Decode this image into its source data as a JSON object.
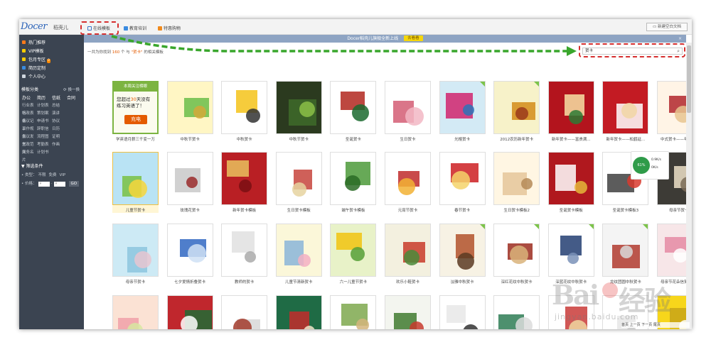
{
  "app": {
    "logo": "Docer",
    "logo_cn": "稻壳儿",
    "tabs": [
      {
        "label": "在线模板",
        "icon": "template-tab-icon"
      },
      {
        "label": "教育培训",
        "icon": "education-tab-icon"
      },
      {
        "label": "特惠购物",
        "icon": "shopping-tab-icon"
      }
    ],
    "new_doc_label": "新建空白文档"
  },
  "sidebar": {
    "nav": [
      {
        "label": "热门推荐",
        "color": "#ff7a1a"
      },
      {
        "label": "VIP模板",
        "color": "#ffcc00"
      },
      {
        "label": "包月专区",
        "color": "#ffcc00",
        "badge": "0"
      },
      {
        "label": "简历定制",
        "color": "#3a8be0"
      },
      {
        "label": "个人中心",
        "color": "#cfd6de"
      }
    ],
    "category_title": "模板分类",
    "swap_label": "换一换",
    "categories": [
      [
        "办公",
        "简历",
        "信纸",
        "合同"
      ],
      [
        "行业表格",
        "计划表",
        "总结"
      ],
      [
        "行政表格",
        "策划案",
        "演讲"
      ],
      [
        "会议记录",
        "申请书",
        "协议"
      ],
      [
        "工作规划",
        "辞职信",
        "日历"
      ],
      [
        "会议发言",
        "流程图",
        "证明"
      ],
      [
        "党政范文",
        "考勤表",
        "作画"
      ],
      [
        "商务名片",
        "计划书"
      ]
    ],
    "filter_title": "筛选条件",
    "filter_type_label": "• 类型：",
    "filter_type_options": [
      "不限",
      "免费",
      "VIP"
    ],
    "filter_price_label": "• 价格：",
    "filter_price_min": "¥",
    "filter_price_max": "¥",
    "go_label": "GO"
  },
  "banner": {
    "text": "Docer稻壳儿旗舰全新上线",
    "button": "去看看",
    "close": "×"
  },
  "results": {
    "prefix": "一共为你找到",
    "count": "160",
    "middle": "个 与",
    "keyword": "\"贺卡\"",
    "suffix": "的相关模板"
  },
  "search": {
    "value": "贺卡"
  },
  "ad_tile": {
    "header": "本周关注榜眼",
    "line1_a": "您超过",
    "line1_num": "30",
    "line1_b": "天没有",
    "line2": "练习英语了！",
    "button": "充电"
  },
  "templates": [
    {
      "caption": "学英语月薪三千变一万",
      "ad": true
    },
    {
      "caption": "中秋节贺卡",
      "palette": [
        "#fff6c4",
        "#6bbd4a",
        "#d4a838"
      ]
    },
    {
      "caption": "中秋贺卡",
      "palette": [
        "#ffffff",
        "#f4c31a",
        "#333333"
      ]
    },
    {
      "caption": "中秋节贺卡",
      "palette": [
        "#2b3a1f",
        "#3e6b2a",
        "#8cc047"
      ]
    },
    {
      "caption": "圣诞贺卡",
      "palette": [
        "#ffffff",
        "#b2271f",
        "#1b6a2f"
      ]
    },
    {
      "caption": "生日贺卡",
      "palette": [
        "#ffffff",
        "#d35d74",
        "#f2b7c4"
      ]
    },
    {
      "caption": "光棍贺卡",
      "palette": [
        "#d3eaf5",
        "#d0246d",
        "#2d73b9"
      ],
      "corner": true
    },
    {
      "caption": "2012农历新年贺卡",
      "palette": [
        "#f7f2c9",
        "#d38c19",
        "#9a3a1b"
      ],
      "corner": true
    },
    {
      "caption": "新年贺卡——富贵满...",
      "palette": [
        "#b3141d",
        "#f7e1a4",
        "#2c7a35"
      ]
    },
    {
      "caption": "新年贺卡——松鹤延...",
      "palette": [
        "#c31b23",
        "#ffffff",
        "#f1d6a4"
      ]
    },
    {
      "caption": "中式贺卡——年年有余",
      "palette": [
        "#fff4e6",
        "#b1262c",
        "#e8c48f"
      ]
    },
    {
      "caption": "儿童节贺卡",
      "palette": [
        "#b9e3f4",
        "#79c143",
        "#f7d63c"
      ],
      "selected": true
    },
    {
      "caption": "玫瑰花贺卡",
      "palette": [
        "#ffffff",
        "#c9c9c9",
        "#9a2b2b"
      ]
    },
    {
      "caption": "新年贺卡模板",
      "palette": [
        "#b91f24",
        "#e9c25e",
        "#7a0f13"
      ]
    },
    {
      "caption": "生日贺卡模板",
      "palette": [
        "#ffffff",
        "#c7443c",
        "#e6d4a0"
      ]
    },
    {
      "caption": "端午贺卡模板",
      "palette": [
        "#ffffff",
        "#4c9a3a",
        "#2a6b25"
      ]
    },
    {
      "caption": "元宵节贺卡",
      "palette": [
        "#ffffff",
        "#c02a2a",
        "#f2b134"
      ]
    },
    {
      "caption": "春节贺卡",
      "palette": [
        "#ffffff",
        "#cd1f22",
        "#f4d36a"
      ]
    },
    {
      "caption": "生日贺卡模板2",
      "palette": [
        "#fff6e3",
        "#e5c69a",
        "#b58a57"
      ]
    },
    {
      "caption": "圣诞贺卡模板",
      "palette": [
        "#b0181e",
        "#ffffff",
        "#e5b73a"
      ]
    },
    {
      "caption": "圣诞贺卡模板3",
      "palette": [
        "#ffffff",
        "#3f3f3f",
        "#d83a2e"
      ]
    },
    {
      "caption": "母亲节贺卡2",
      "palette": [
        "#3d3b36",
        "#ece0c7",
        "#7a6b58"
      ]
    },
    {
      "caption": "母亲节贺卡",
      "palette": [
        "#cdeaf5",
        "#8cc6de",
        "#e7c6d0"
      ]
    },
    {
      "caption": "七夕爱情折叠贺卡",
      "palette": [
        "#ffffff",
        "#3067c2",
        "#cfe0f5"
      ]
    },
    {
      "caption": "教师的贺卡",
      "palette": [
        "#ffffff",
        "#e0e0e0",
        "#aaaaaa"
      ]
    },
    {
      "caption": "儿童节清新贺卡",
      "palette": [
        "#fbf7d9",
        "#8ab5d8",
        "#f3b0c3"
      ]
    },
    {
      "caption": "六一儿童节贺卡",
      "palette": [
        "#e8f2c8",
        "#f1c40f",
        "#56a037"
      ]
    },
    {
      "caption": "欢乐小鞋贺卡",
      "palette": [
        "#f3f0df",
        "#c83b2a",
        "#4a8a3a"
      ]
    },
    {
      "caption": "淡雅中秋贺卡",
      "palette": [
        "#f7f2e4",
        "#b2522c",
        "#5b3a22"
      ],
      "corner": true
    },
    {
      "caption": "深红花纹中秋贺卡",
      "palette": [
        "#ffffff",
        "#9b2b1e",
        "#d9b37a"
      ],
      "corner": true
    },
    {
      "caption": "深蓝花纹中秋贺卡",
      "palette": [
        "#ffffff",
        "#233e72",
        "#7a92b8"
      ],
      "corner": true
    },
    {
      "caption": "龙纹团圆中秋贺卡",
      "palette": [
        "#f4f4f4",
        "#b03a2e",
        "#d9d9d9"
      ],
      "corner": true
    },
    {
      "caption": "母亲节花朵信笺贺卡通",
      "palette": [
        "#f7e6e8",
        "#e58aa3",
        "#ffffff"
      ],
      "corner": true
    },
    {
      "caption": "",
      "palette": [
        "#fbe2d4",
        "#f0a0a8",
        "#d7e7a1"
      ]
    },
    {
      "caption": "",
      "palette": [
        "#c0272d",
        "#1f6c35",
        "#ffffff"
      ]
    },
    {
      "caption": "",
      "palette": [
        "#ffffff",
        "#d8d8d8",
        "#a23b2b"
      ]
    },
    {
      "caption": "",
      "palette": [
        "#1f6b45",
        "#c32b2b",
        "#f1e5c8"
      ]
    },
    {
      "caption": "",
      "palette": [
        "#ffffff",
        "#7ea84e",
        "#d3b57d"
      ]
    },
    {
      "caption": "",
      "palette": [
        "#f3f5ef",
        "#3f7a2f",
        "#c73b2e"
      ]
    },
    {
      "caption": "",
      "palette": [
        "#ffffff",
        "#e7e7e7",
        "#333333"
      ]
    },
    {
      "caption": "",
      "palette": [
        "#ffffff",
        "#2e7d55",
        "#dcdcdc"
      ]
    },
    {
      "caption": "",
      "palette": [
        "#ffffff",
        "#c93b38",
        "#f0d7a0"
      ]
    },
    {
      "caption": "",
      "palette": [
        "#ffffff",
        "#e6e6e6",
        "#c8c8c8"
      ]
    },
    {
      "caption": "",
      "palette": [
        "#f7d61b",
        "#c8a417",
        "#ffffff"
      ]
    }
  ],
  "widget": {
    "percent": "61%",
    "up": "0.9K/s",
    "down": "0K/s"
  },
  "watermark": {
    "brand": "Bai",
    "brand2": "经验",
    "sub": "jingyan.baidu.com"
  },
  "pager": {
    "first": "首页",
    "prev": "上一页",
    "next": "下一页",
    "last": "尾页"
  }
}
